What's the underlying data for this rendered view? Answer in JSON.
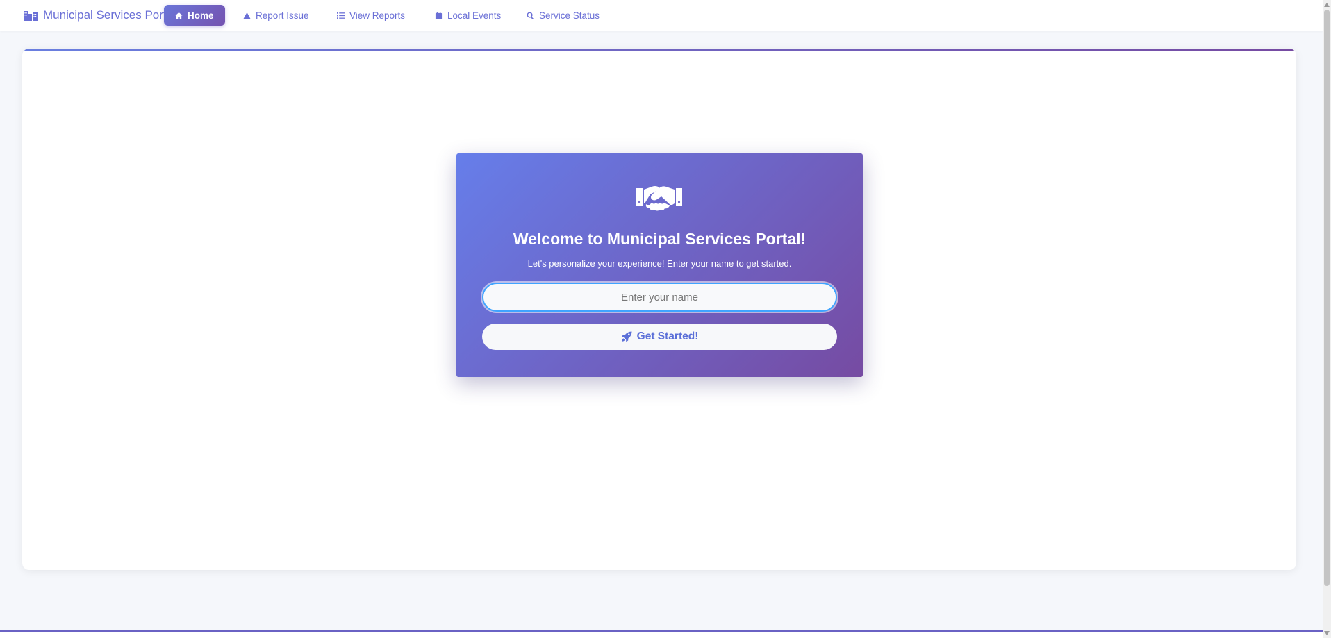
{
  "header": {
    "brand": {
      "icon": "building-icon",
      "label": "Municipal Services Portal"
    },
    "nav": [
      {
        "label": "Home",
        "icon": "home-icon",
        "active": true
      },
      {
        "label": "Report Issue",
        "icon": "warning-icon",
        "active": false
      },
      {
        "label": "View Reports",
        "icon": "list-icon",
        "active": false
      },
      {
        "label": "Local Events",
        "icon": "calendar-icon",
        "active": false
      },
      {
        "label": "Service Status",
        "icon": "search-icon",
        "active": false
      }
    ]
  },
  "welcome": {
    "icon": "handshake-icon",
    "title": "Welcome to Municipal Services Portal!",
    "subtitle": "Let's personalize your experience! Enter your name to get started.",
    "name_input": {
      "placeholder": "Enter your name",
      "value": ""
    },
    "button": {
      "icon": "rocket-icon",
      "label": "Get Started!"
    }
  },
  "colors": {
    "accent": "#6a6fd6",
    "gradient_start": "#667eea",
    "gradient_end": "#764ba2",
    "input_focus": "#3fa4ff"
  }
}
